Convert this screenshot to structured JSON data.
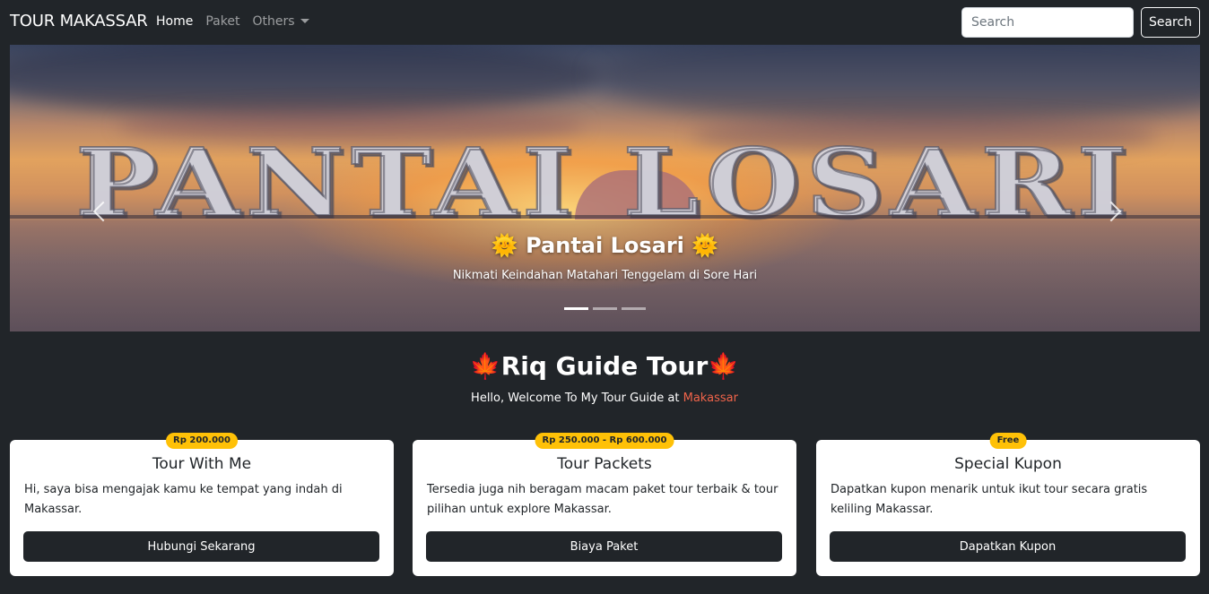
{
  "navbar": {
    "brand": "TOUR MAKASSAR",
    "links": [
      {
        "label": "Home",
        "active": true
      },
      {
        "label": "Paket",
        "active": false
      },
      {
        "label": "Others",
        "active": false,
        "dropdown": true
      }
    ],
    "search_placeholder": "Search",
    "search_button": "Search"
  },
  "carousel": {
    "sign_text": "PANTAI LOSARI",
    "caption_title": "🌞 Pantai Losari 🌞",
    "caption_text": "Nikmati Keindahan Matahari Tenggelam di Sore Hari",
    "slide_count": 3,
    "active_slide": 1,
    "prev_icon": "chevron-left-icon",
    "next_icon": "chevron-right-icon"
  },
  "hero": {
    "title_text": "Riq Guide Tour",
    "leaf_icon": "🍁",
    "subtitle_prefix": "Hello, Welcome To My Tour Guide at ",
    "subtitle_accent": "Makassar"
  },
  "cards": [
    {
      "badge": "Rp 200.000",
      "title": "Tour With Me",
      "text": "Hi, saya bisa mengajak kamu ke tempat yang indah di Makassar.",
      "button": "Hubungi Sekarang"
    },
    {
      "badge": "Rp 250.000 - Rp 600.000",
      "title": "Tour Packets",
      "text": "Tersedia juga nih beragam macam paket tour terbaik & tour pilihan untuk explore Makassar.",
      "button": "Biaya Paket"
    },
    {
      "badge": "Free",
      "title": "Special Kupon",
      "text": "Dapatkan kupon menarik untuk ikut tour secara gratis keliling Makassar.",
      "button": "Dapatkan Kupon"
    }
  ],
  "colors": {
    "background": "#212529",
    "badge": "#ffc107",
    "accent": "#f0644a"
  }
}
